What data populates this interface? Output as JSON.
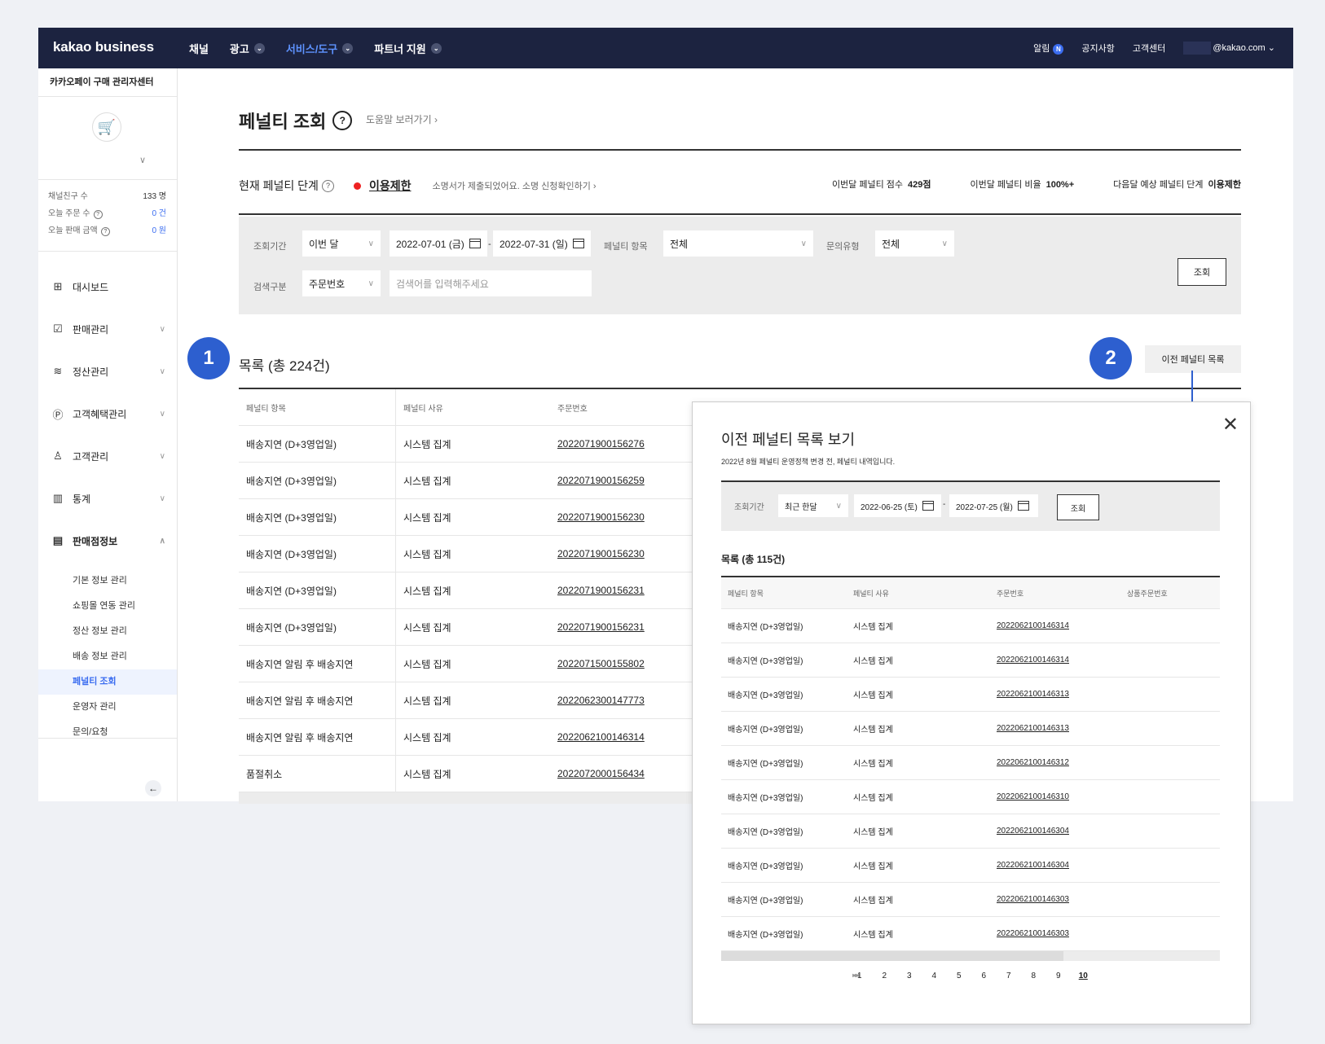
{
  "topbar": {
    "logo": "kakao business",
    "nav": [
      {
        "label": "채널",
        "caret": false,
        "active": false
      },
      {
        "label": "광고",
        "caret": true,
        "active": false
      },
      {
        "label": "서비스/도구",
        "caret": true,
        "active": true
      },
      {
        "label": "파트너 지원",
        "caret": true,
        "active": false
      }
    ],
    "notice_label": "알림",
    "notice_badge": "N",
    "announcements": "공지사항",
    "support": "고객센터",
    "account": "@kakao.com"
  },
  "sidebar": {
    "title": "카카오페이 구매 관리자센터",
    "stats": [
      {
        "label": "채널친구 수",
        "value": "133 명",
        "help": false
      },
      {
        "label": "오늘 주문 수",
        "value": "0 건",
        "help": true
      },
      {
        "label": "오늘 판매 금액",
        "value": "0 원",
        "help": true
      }
    ],
    "menu": [
      {
        "label": "대시보드",
        "icon": "dashboard-icon",
        "glyph": "⊞",
        "chev": ""
      },
      {
        "label": "판매관리",
        "icon": "clipboard-icon",
        "glyph": "☑",
        "chev": "∨"
      },
      {
        "label": "정산관리",
        "icon": "database-icon",
        "glyph": "≋",
        "chev": "∨"
      },
      {
        "label": "고객혜택관리",
        "icon": "point-icon",
        "glyph": "Ⓟ",
        "chev": "∨"
      },
      {
        "label": "고객관리",
        "icon": "person-icon",
        "glyph": "♙",
        "chev": "∨"
      },
      {
        "label": "통계",
        "icon": "chart-icon",
        "glyph": "▥",
        "chev": "∨"
      },
      {
        "label": "판매점정보",
        "icon": "store-icon",
        "glyph": "▤",
        "chev": "∧"
      }
    ],
    "submenu": [
      {
        "label": "기본 정보 관리",
        "active": false
      },
      {
        "label": "쇼핑몰 연동 관리",
        "active": false
      },
      {
        "label": "정산 정보 관리",
        "active": false
      },
      {
        "label": "배송 정보 관리",
        "active": false
      },
      {
        "label": "페널티 조회",
        "active": true
      },
      {
        "label": "운영자 관리",
        "active": false
      },
      {
        "label": "문의/요청",
        "active": false
      }
    ]
  },
  "page": {
    "title": "페널티 조회",
    "help_link": "도움말 보러가기 ›",
    "status_label": "현재 페널티 단계",
    "status_value": "이용제한",
    "status_note": "소명서가 제출되었어요. 소명 신청확인하기 ›",
    "metric1_label": "이번달 페널티 점수",
    "metric1_value": "429점",
    "metric2_label": "이번달 페널티 비율",
    "metric2_value": "100%+",
    "metric3_label": "다음달 예상 페널티 단계",
    "metric3_value": "이용제한"
  },
  "filter": {
    "period_label": "조회기간",
    "period_value": "이번 달",
    "start_date": "2022-07-01 (금)",
    "date_sep": "-",
    "end_date": "2022-07-31 (일)",
    "item_label": "페널티 항목",
    "item_value": "전체",
    "inquiry_label": "문의유형",
    "inquiry_value": "전체",
    "search_label": "검색구분",
    "search_type": "주문번호",
    "search_placeholder": "검색어를 입력해주세요",
    "search_button": "조회"
  },
  "list": {
    "title": "목록 (총 224건)",
    "prev_button": "이전 페널티 목록",
    "headers": [
      "페널티 항목",
      "페널티 사유",
      "주문번호"
    ],
    "rows": [
      [
        "배송지연 (D+3영업일)",
        "시스템 집계",
        "2022071900156276"
      ],
      [
        "배송지연 (D+3영업일)",
        "시스템 집계",
        "2022071900156259"
      ],
      [
        "배송지연 (D+3영업일)",
        "시스템 집계",
        "2022071900156230"
      ],
      [
        "배송지연 (D+3영업일)",
        "시스템 집계",
        "2022071900156230"
      ],
      [
        "배송지연 (D+3영업일)",
        "시스템 집계",
        "2022071900156231"
      ],
      [
        "배송지연 (D+3영업일)",
        "시스템 집계",
        "2022071900156231"
      ],
      [
        "배송지연 알림 후 배송지연",
        "시스템 집계",
        "2022071500155802"
      ],
      [
        "배송지연 알림 후 배송지연",
        "시스템 집계",
        "2022062300147773"
      ],
      [
        "배송지연 알림 후 배송지연",
        "시스템 집계",
        "2022062100146314"
      ],
      [
        "품절취소",
        "시스템 집계",
        "2022072000156434"
      ]
    ]
  },
  "callouts": {
    "one": "1",
    "two": "2"
  },
  "modal": {
    "title": "이전 페널티 목록 보기",
    "desc": "2022년 8월 페널티 운영정책 변경 전, 페널티 내역입니다.",
    "period_label": "조회기간",
    "period_value": "최근 한달",
    "start_date": "2022-06-25 (토)",
    "date_sep": "-",
    "end_date": "2022-07-25 (월)",
    "search_button": "조회",
    "list_title": "목록 (총 115건)",
    "headers": [
      "페널티 항목",
      "페널티 사유",
      "주문번호",
      "상품주문번호"
    ],
    "rows": [
      [
        "배송지연 (D+3영업일)",
        "시스템 집계",
        "2022062100146314"
      ],
      [
        "배송지연 (D+3영업일)",
        "시스템 집계",
        "2022062100146314"
      ],
      [
        "배송지연 (D+3영업일)",
        "시스템 집계",
        "2022062100146313"
      ],
      [
        "배송지연 (D+3영업일)",
        "시스템 집계",
        "2022062100146313"
      ],
      [
        "배송지연 (D+3영업일)",
        "시스템 집계",
        "2022062100146312"
      ],
      [
        "배송지연 (D+3영업일)",
        "시스템 집계",
        "2022062100146310"
      ],
      [
        "배송지연 (D+3영업일)",
        "시스템 집계",
        "2022062100146304"
      ],
      [
        "배송지연 (D+3영업일)",
        "시스템 집계",
        "2022062100146304"
      ],
      [
        "배송지연 (D+3영업일)",
        "시스템 집계",
        "2022062100146303"
      ],
      [
        "배송지연 (D+3영업일)",
        "시스템 집계",
        "2022062100146303"
      ]
    ],
    "pager_first": "◂◂",
    "pages": [
      "1",
      "2",
      "3",
      "4",
      "5",
      "6",
      "7",
      "8",
      "9",
      "10"
    ],
    "current_page": "10",
    "pager_last": "▸▸"
  }
}
